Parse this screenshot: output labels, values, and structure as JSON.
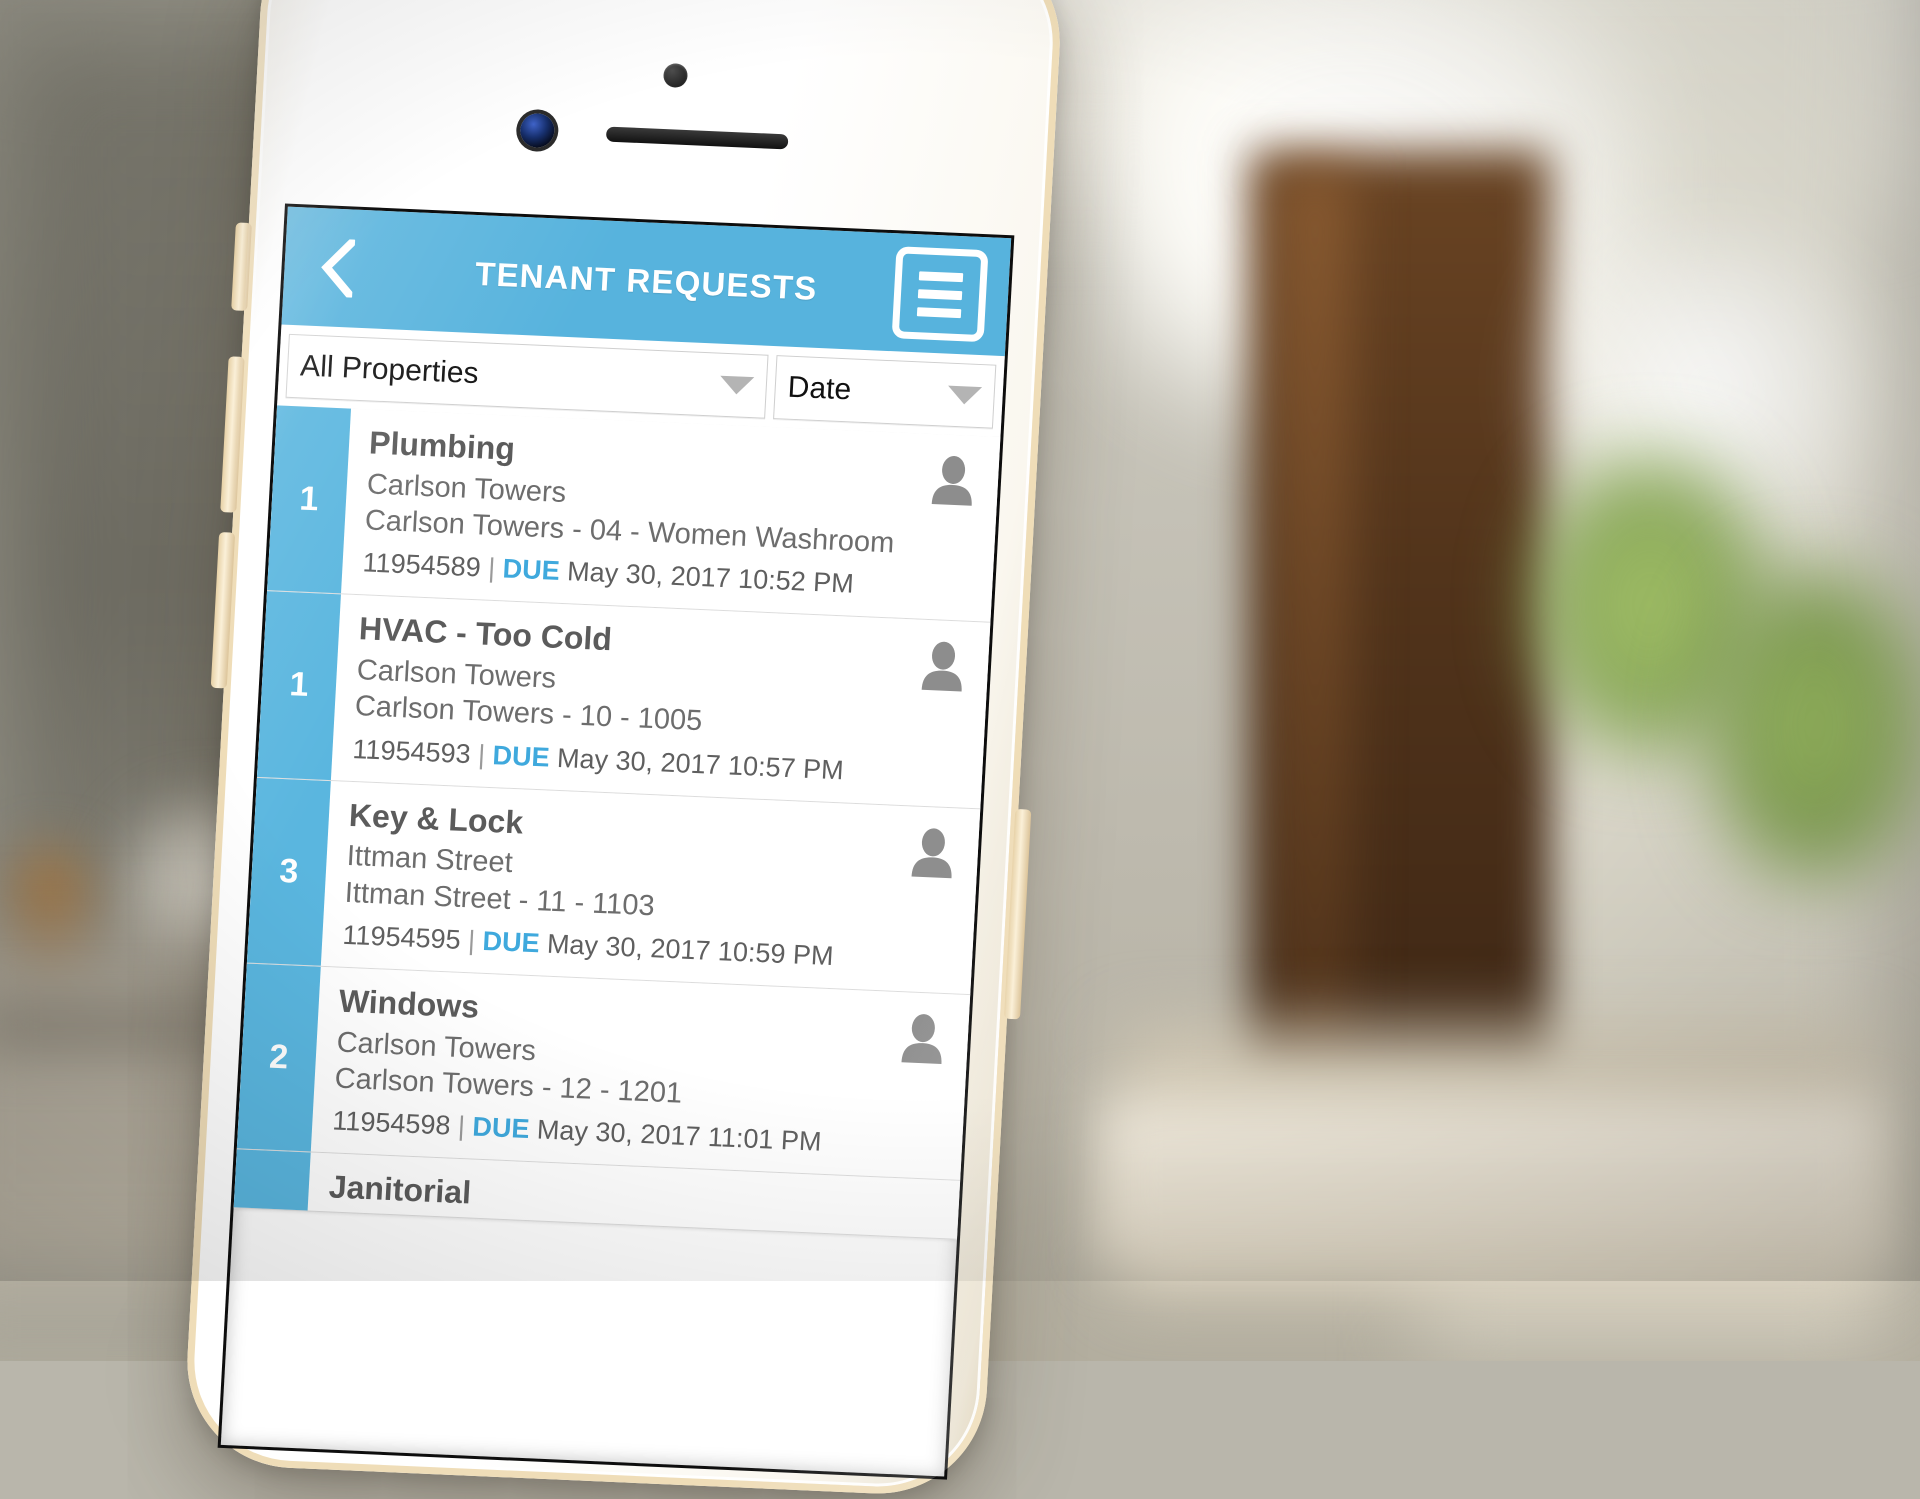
{
  "app": {
    "header": {
      "title": "TENANT REQUESTS",
      "back_icon": "chevron-left-icon",
      "menu_icon": "hamburger-menu-icon",
      "accent_color": "#57b3dd"
    },
    "filters": {
      "property": {
        "value": "All Properties",
        "caret_icon": "caret-down-icon"
      },
      "sort": {
        "value": "Date",
        "caret_icon": "caret-down-icon"
      }
    },
    "list": {
      "due_label": "DUE",
      "separator": "|",
      "avatar_icon": "person-avatar-icon",
      "items": [
        {
          "priority": "1",
          "title": "Plumbing",
          "property": "Carlson Towers",
          "location": "Carlson Towers - 04 - Women Washroom",
          "id": "11954589",
          "due": "May 30, 2017 10:52 PM"
        },
        {
          "priority": "1",
          "title": "HVAC - Too Cold",
          "property": "Carlson Towers",
          "location": "Carlson Towers - 10 - 1005",
          "id": "11954593",
          "due": "May 30, 2017 10:57 PM"
        },
        {
          "priority": "3",
          "title": "Key & Lock",
          "property": "Ittman Street",
          "location": "Ittman Street - 11 - 1103",
          "id": "11954595",
          "due": "May 30, 2017 10:59 PM"
        },
        {
          "priority": "2",
          "title": "Windows",
          "property": "Carlson Towers",
          "location": "Carlson Towers - 12 - 1201",
          "id": "11954598",
          "due": "May 30, 2017 11:01 PM"
        },
        {
          "priority": "",
          "title": "Janitorial",
          "property": "",
          "location": "",
          "id": "",
          "due": ""
        }
      ]
    }
  },
  "device": {
    "frame_color": "#e8d6ae",
    "body_color": "#ffffff",
    "buttons": [
      "silent-switch",
      "volume-up-button",
      "volume-down-button",
      "power-button"
    ],
    "hardware": [
      "proximity-sensor",
      "front-camera",
      "earpiece-speaker"
    ]
  }
}
